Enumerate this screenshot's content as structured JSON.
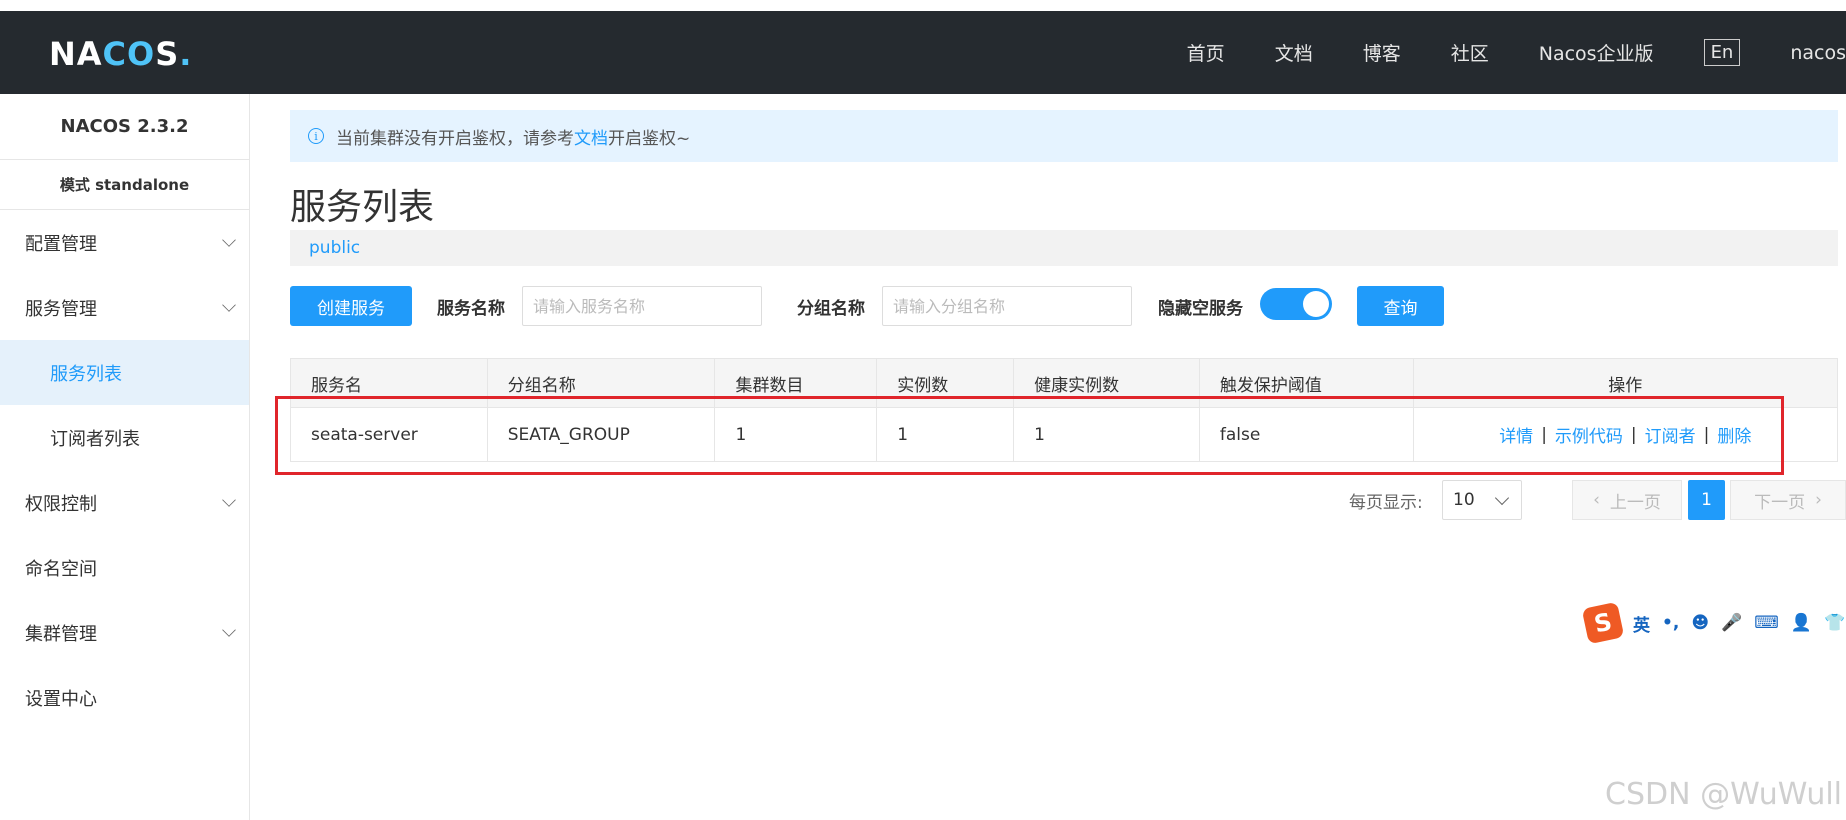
{
  "header": {
    "logo": "NACOS.",
    "nav": [
      "首页",
      "文档",
      "博客",
      "社区",
      "Nacos企业版"
    ],
    "lang": "En",
    "user": "nacos"
  },
  "sidebar": {
    "version": "NACOS 2.3.2",
    "mode": "模式 standalone",
    "items": [
      {
        "label": "配置管理",
        "expandable": true
      },
      {
        "label": "服务管理",
        "expandable": true
      },
      {
        "label": "服务列表",
        "sub": true,
        "active": true
      },
      {
        "label": "订阅者列表",
        "sub": true
      },
      {
        "label": "权限控制",
        "expandable": true
      },
      {
        "label": "命名空间"
      },
      {
        "label": "集群管理",
        "expandable": true
      },
      {
        "label": "设置中心"
      }
    ]
  },
  "notice": {
    "before": "当前集群没有开启鉴权，请参考",
    "link": "文档",
    "after": "开启鉴权~"
  },
  "page": {
    "title": "服务列表",
    "namespace": "public"
  },
  "toolbar": {
    "create_label": "创建服务",
    "service_name_label": "服务名称",
    "service_name_placeholder": "请输入服务名称",
    "group_name_label": "分组名称",
    "group_name_placeholder": "请输入分组名称",
    "hide_empty_label": "隐藏空服务",
    "hide_empty_on": true,
    "query_label": "查询"
  },
  "table": {
    "columns": [
      "服务名",
      "分组名称",
      "集群数目",
      "实例数",
      "健康实例数",
      "触发保护阈值",
      "操作"
    ],
    "rows": [
      {
        "service": "seata-server",
        "group": "SEATA_GROUP",
        "clusters": "1",
        "instances": "1",
        "healthy": "1",
        "threshold": "false"
      }
    ],
    "actions": [
      "详情",
      "示例代码",
      "订阅者",
      "删除"
    ]
  },
  "pagination": {
    "per_page_label": "每页显示:",
    "per_page_value": "10",
    "prev_label": "上一页",
    "current": "1",
    "next_label": "下一页"
  },
  "ime": {
    "logo": "S",
    "lang": "英",
    "items": [
      "•,",
      "☻",
      "🎤",
      "⌨",
      "👤",
      "👕"
    ]
  },
  "watermark": "CSDN @WuWull",
  "colors": {
    "accent": "#209bfa",
    "topbar": "#252a2f",
    "highlight_box": "#e0252b"
  }
}
